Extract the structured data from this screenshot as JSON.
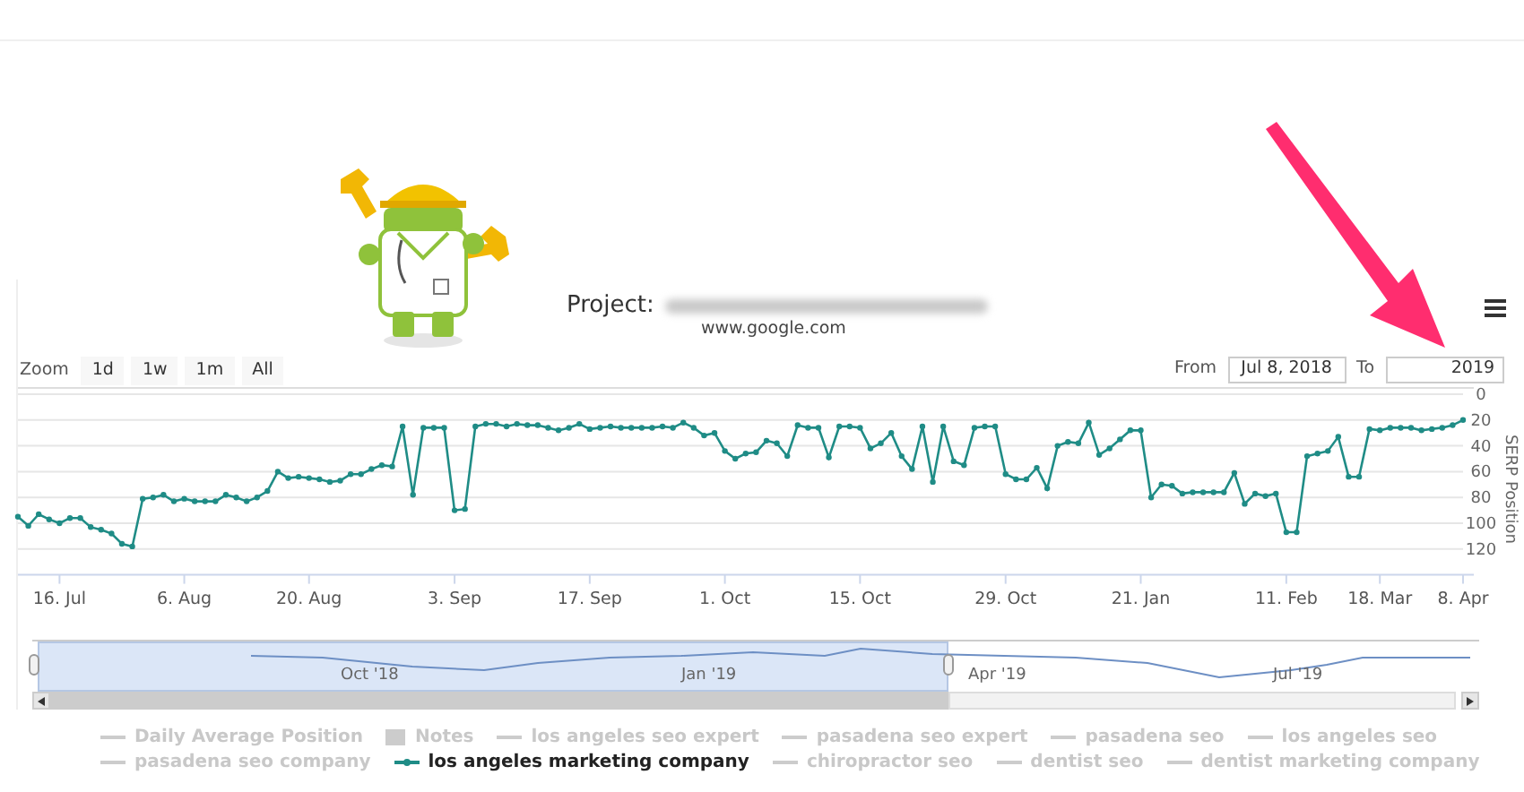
{
  "header": {
    "project_label": "Project:",
    "domain": "www.google.com"
  },
  "zoom": {
    "label": "Zoom",
    "buttons": [
      {
        "label": "1d",
        "selected": false
      },
      {
        "label": "1w",
        "selected": false
      },
      {
        "label": "1m",
        "selected": false
      },
      {
        "label": "All",
        "selected": false
      }
    ]
  },
  "range": {
    "from_label": "From",
    "from_value": "Jul 8, 2018",
    "to_label": "To",
    "to_value": "2019"
  },
  "chart_data": {
    "type": "line",
    "ylabel": "SERP Position",
    "ylim": [
      140,
      0
    ],
    "grid": true,
    "categories": [
      null,
      null,
      null,
      null,
      "16. Jul",
      null,
      null,
      null,
      null,
      null,
      null,
      null,
      null,
      null,
      null,
      null,
      "6. Aug",
      null,
      null,
      null,
      null,
      null,
      null,
      null,
      null,
      null,
      null,
      null,
      "20. Aug",
      null,
      null,
      null,
      null,
      null,
      null,
      null,
      null,
      null,
      null,
      null,
      null,
      null,
      "3. Sep",
      null,
      null,
      null,
      null,
      null,
      null,
      null,
      null,
      null,
      null,
      null,
      null,
      "17. Sep",
      null,
      null,
      null,
      null,
      null,
      null,
      null,
      null,
      null,
      null,
      null,
      null,
      "1. Oct",
      null,
      null,
      null,
      null,
      null,
      null,
      null,
      null,
      null,
      null,
      null,
      null,
      "15. Oct",
      null,
      null,
      null,
      null,
      null,
      null,
      null,
      null,
      null,
      null,
      null,
      null,
      null,
      "29. Oct",
      null,
      null,
      null,
      null,
      null,
      null,
      null,
      null,
      null,
      null,
      null,
      null,
      "21. Jan",
      null,
      null,
      null,
      null,
      null,
      null,
      null,
      null,
      null,
      null,
      null,
      null,
      null,
      "11. Feb",
      null,
      null,
      null,
      null,
      null,
      null,
      null,
      null,
      "18. Mar",
      null,
      null,
      null,
      null,
      null,
      null,
      null,
      "8. Apr"
    ],
    "yticks": [
      0,
      20,
      40,
      60,
      80,
      100,
      120
    ],
    "series": [
      {
        "color": "#1f8c86",
        "marker": true,
        "values": [
          95,
          102,
          93,
          97,
          100,
          96,
          96,
          103,
          105,
          108,
          116,
          118,
          81,
          80,
          78,
          83,
          81,
          83,
          83,
          83,
          78,
          80,
          83,
          80,
          75,
          60,
          65,
          64,
          65,
          66,
          68,
          67,
          62,
          62,
          58,
          55,
          56,
          25,
          78,
          26,
          26,
          26,
          90,
          89,
          25,
          23,
          23,
          25,
          23,
          24,
          24,
          26,
          28,
          26,
          23,
          27,
          26,
          25,
          26,
          26,
          26,
          26,
          25,
          26,
          22,
          26,
          32,
          30,
          44,
          50,
          46,
          45,
          36,
          38,
          48,
          24,
          26,
          26,
          49,
          25,
          25,
          26,
          42,
          38,
          30,
          48,
          58,
          25,
          68,
          25,
          52,
          55,
          26,
          25,
          25,
          62,
          66,
          66,
          57,
          73,
          40,
          37,
          38,
          22,
          47,
          42,
          35,
          28,
          28,
          80,
          70,
          71,
          77,
          76,
          76,
          76,
          76,
          61,
          85,
          77,
          79,
          77,
          107,
          107,
          48,
          46,
          44,
          33,
          64,
          64,
          27,
          28,
          26,
          26,
          26,
          28,
          27,
          26,
          24,
          20
        ]
      }
    ]
  },
  "navigator": {
    "labels": [
      "Oct '18",
      "Jan '19",
      "Apr '19",
      "Jul '19"
    ],
    "level": 0.63
  },
  "legend": [
    {
      "label": "Daily Average Position",
      "kind": "line",
      "selected": false
    },
    {
      "label": "Notes",
      "kind": "box",
      "selected": false
    },
    {
      "label": "los angeles seo expert",
      "kind": "line",
      "selected": false
    },
    {
      "label": "pasadena seo expert",
      "kind": "line",
      "selected": false
    },
    {
      "label": "pasadena seo",
      "kind": "line",
      "selected": false
    },
    {
      "label": "los angeles seo",
      "kind": "line",
      "selected": false
    },
    {
      "label": "pasadena seo company",
      "kind": "line",
      "selected": false
    },
    {
      "label": "los angeles marketing company",
      "kind": "line",
      "selected": true
    },
    {
      "label": "chiropractor seo",
      "kind": "line",
      "selected": false
    },
    {
      "label": "dentist seo",
      "kind": "line",
      "selected": false
    },
    {
      "label": "dentist marketing company",
      "kind": "line",
      "selected": false
    }
  ]
}
